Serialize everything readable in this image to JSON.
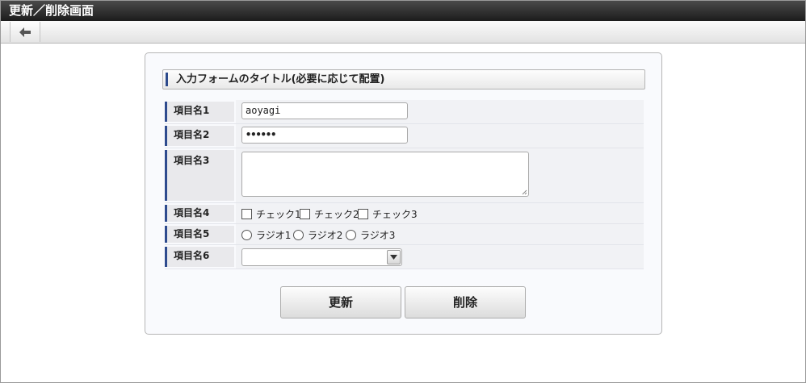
{
  "window": {
    "title": "更新／削除画面"
  },
  "toolbar": {
    "back_icon": "arrow-left-icon"
  },
  "form": {
    "title": "入力フォームのタイトル(必要に応じて配置)",
    "fields": [
      {
        "label": "項目名1",
        "type": "text",
        "value": "aoyagi"
      },
      {
        "label": "項目名2",
        "type": "password",
        "value": "••••••"
      },
      {
        "label": "項目名3",
        "type": "textarea",
        "value": ""
      },
      {
        "label": "項目名4",
        "type": "checkbox",
        "options": [
          "チェック1",
          "チェック2",
          "チェック3"
        ]
      },
      {
        "label": "項目名5",
        "type": "radio",
        "options": [
          "ラジオ1",
          "ラジオ2",
          "ラジオ3"
        ]
      },
      {
        "label": "項目名6",
        "type": "select",
        "value": ""
      }
    ],
    "buttons": {
      "update": "更新",
      "delete": "削除"
    }
  },
  "colors": {
    "title_bar": "#2b2b2b",
    "accent_bar": "#2e4b8e"
  }
}
